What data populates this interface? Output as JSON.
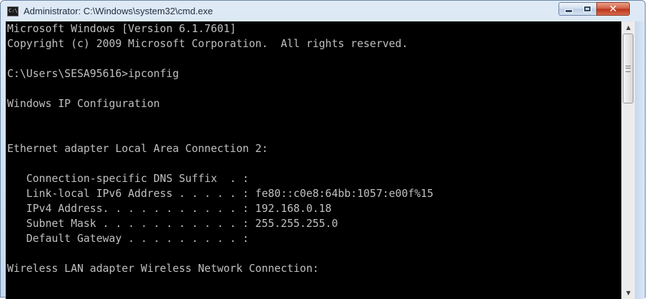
{
  "window": {
    "title": "Administrator: C:\\Windows\\system32\\cmd.exe",
    "icon_label": "C:\\",
    "icons": {
      "app": "command-prompt-icon",
      "minimize": "minimize-icon",
      "maximize": "maximize-icon",
      "close": "close-icon"
    },
    "close_glyph": "✕",
    "scroll_up_glyph": "▲",
    "scroll_down_glyph": "▼"
  },
  "console": {
    "lines": [
      "Microsoft Windows [Version 6.1.7601]",
      "Copyright (c) 2009 Microsoft Corporation.  All rights reserved.",
      "",
      "C:\\Users\\SESA95616>ipconfig",
      "",
      "Windows IP Configuration",
      "",
      "",
      "Ethernet adapter Local Area Connection 2:",
      "",
      "   Connection-specific DNS Suffix  . :",
      "   Link-local IPv6 Address . . . . . : fe80::c0e8:64bb:1057:e00f%15",
      "   IPv4 Address. . . . . . . . . . . : 192.168.0.18",
      "   Subnet Mask . . . . . . . . . . . : 255.255.255.0",
      "   Default Gateway . . . . . . . . . :",
      "",
      "Wireless LAN adapter Wireless Network Connection:"
    ]
  },
  "colors": {
    "console_background": "#000000",
    "console_text": "#c0c0c0",
    "close_button": "#c9472b"
  }
}
